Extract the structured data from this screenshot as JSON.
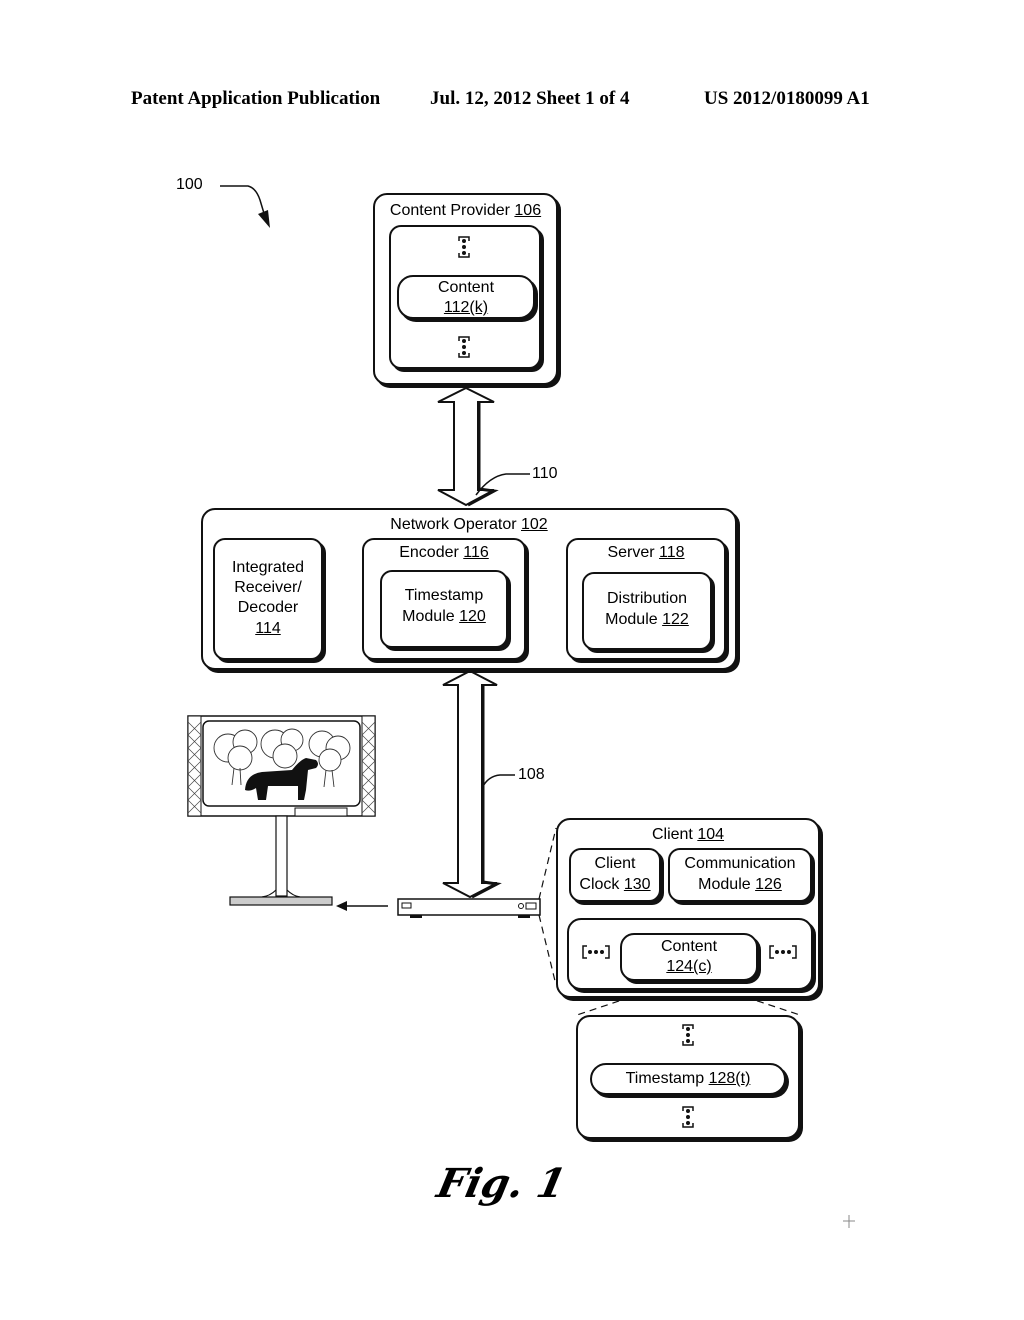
{
  "header": {
    "publication": "Patent Application Publication",
    "date_sheet": "Jul. 12, 2012   Sheet 1 of 4",
    "number": "US 2012/0180099 A1"
  },
  "figure": {
    "ref_system": "100",
    "caption": "Fig. 1",
    "content_provider": {
      "name": "Content Provider",
      "ref": "106"
    },
    "content_k": {
      "name": "Content",
      "ref": "112(k)"
    },
    "link_110": {
      "ref": "110"
    },
    "network_operator": {
      "name": "Network Operator",
      "ref": "102"
    },
    "ird": {
      "line1": "Integrated",
      "line2": "Receiver/",
      "line3": "Decoder",
      "ref": "114"
    },
    "encoder": {
      "name": "Encoder",
      "ref": "116"
    },
    "timestamp_module": {
      "line1": "Timestamp",
      "line2": "Module",
      "ref": "120"
    },
    "server": {
      "name": "Server",
      "ref": "118"
    },
    "distribution_module": {
      "line1": "Distribution",
      "line2": "Module",
      "ref": "122"
    },
    "link_108": {
      "ref": "108"
    },
    "client": {
      "name": "Client",
      "ref": "104"
    },
    "client_clock": {
      "line1": "Client",
      "line2": "Clock",
      "ref": "130"
    },
    "communication_module": {
      "line1": "Communication",
      "line2": "Module",
      "ref": "126"
    },
    "content_c": {
      "name": "Content",
      "ref": "124(c)"
    },
    "timestamp": {
      "name": "Timestamp",
      "ref": "128(t)"
    }
  }
}
